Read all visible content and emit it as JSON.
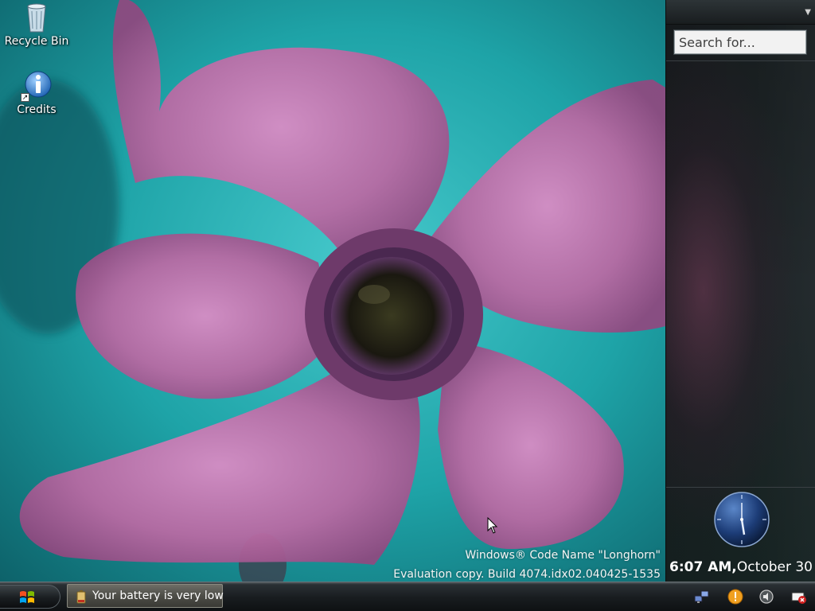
{
  "desktop": {
    "icons": [
      {
        "label": "Recycle Bin",
        "icon": "recycle-bin-icon"
      },
      {
        "label": "Credits",
        "icon": "info-icon"
      }
    ],
    "watermark": {
      "line1": "Windows® Code Name \"Longhorn\"",
      "line2": "Evaluation copy. Build 4074.idx02.040425-1535"
    }
  },
  "sidebar": {
    "search_placeholder": "Search for...",
    "clock": {
      "time": "6:07 AM,",
      "date": "October 30"
    }
  },
  "taskbar": {
    "start_icon": "windows-logo-icon",
    "task_items": [
      {
        "label": "Your battery is very low",
        "icon": "battery-warning-icon"
      }
    ],
    "tray_icons": [
      "network-icon",
      "notification-icon",
      "volume-icon",
      "power-warning-icon"
    ]
  },
  "colors": {
    "wallpaper_teal": "#1fa2a6",
    "flower_pink": "#c77bb0",
    "sidebar_dark": "#1d2426",
    "taskbar_dark": "#181c1f"
  }
}
